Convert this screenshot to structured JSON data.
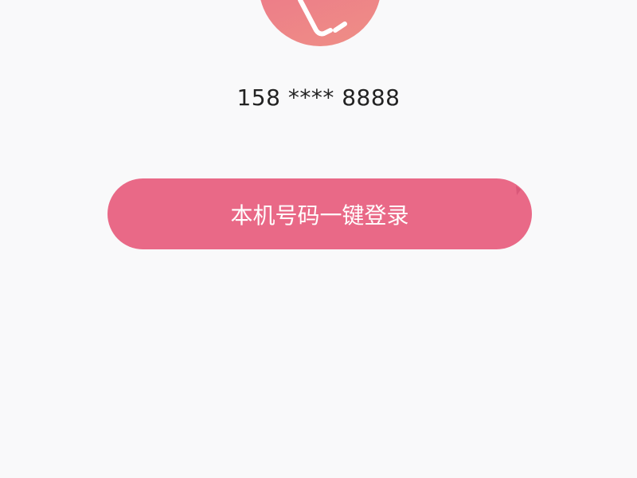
{
  "app": {
    "logo_icon": "pink-tag-logo-icon"
  },
  "account": {
    "masked_phone": "158 **** 8888"
  },
  "actions": {
    "one_click_login_label": "本机号码一键登录"
  },
  "colors": {
    "background": "#f9f9fa",
    "accent": "#e96987",
    "logo_gradient_start": "#ec6f8a",
    "logo_gradient_end": "#ee8f86",
    "text": "#222222"
  }
}
